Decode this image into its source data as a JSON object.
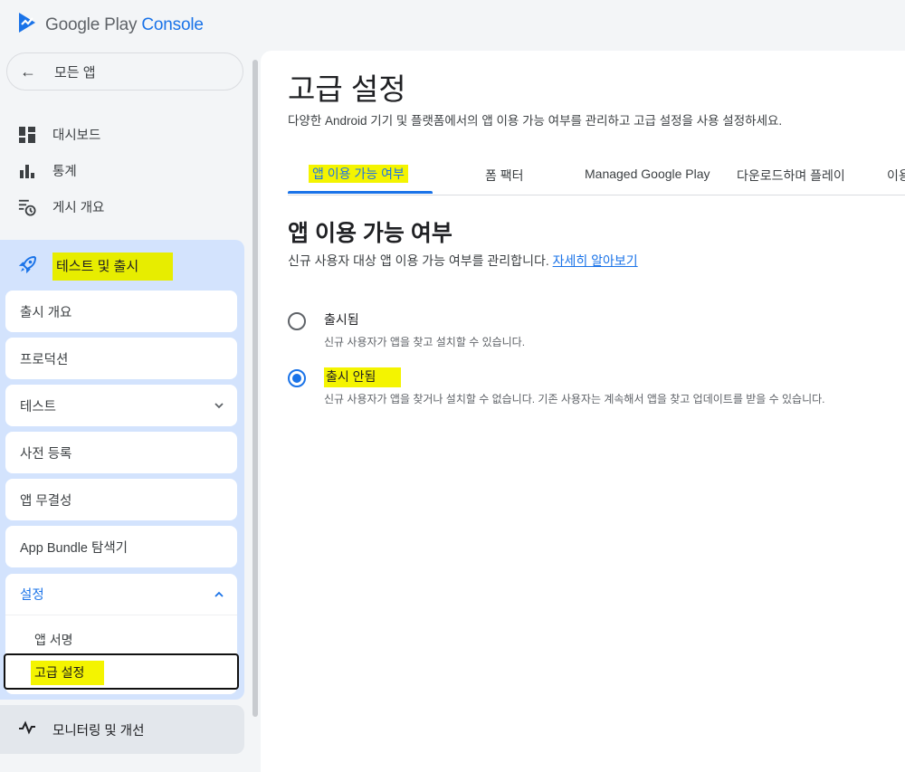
{
  "app": {
    "logo_text_main": "Google Play ",
    "logo_text_accent": "Console",
    "accent_color": "#1a73e8",
    "highlight_color": "#f4f400"
  },
  "sidebar": {
    "back_label": "모든 앱",
    "items": [
      {
        "label": "대시보드",
        "icon": "dashboard-icon"
      },
      {
        "label": "통계",
        "icon": "bar-chart-icon"
      },
      {
        "label": "게시 개요",
        "icon": "publishing-overview-icon"
      }
    ],
    "test_release": {
      "label": "테스트 및 출시",
      "icon": "rocket-icon",
      "sub_items": [
        {
          "label": "출시 개요"
        },
        {
          "label": "프로덕션"
        },
        {
          "label": "테스트",
          "icon": "chevron-down-icon"
        },
        {
          "label": "사전 등록"
        },
        {
          "label": "앱 무결성"
        },
        {
          "label": "App Bundle 탐색기"
        }
      ],
      "settings": {
        "label": "설정",
        "icon": "chevron-up-icon",
        "children": [
          "앱 서명",
          "고급 설정"
        ],
        "selected": "고급 설정"
      }
    },
    "monitor_label": "모니터링 및 개선"
  },
  "main": {
    "title": "고급 설정",
    "description": "다양한 Android 기기 및 플랫폼에서의 앱 이용 가능 여부를 관리하고 고급 설정을 사용 설정하세요.",
    "tabs": [
      "앱 이용 가능 여부",
      "폼 팩터",
      "Managed Google Play",
      "다운로드하며 플레이",
      "이용"
    ],
    "active_tab": "앱 이용 가능 여부",
    "section_title": "앱 이용 가능 여부",
    "section_desc": "신규 사용자 대상 앱 이용 가능 여부를 관리합니다. ",
    "section_link": "자세히 알아보기",
    "options": [
      {
        "label": "출시됨",
        "help": "신규 사용자가 앱을 찾고 설치할 수 있습니다.",
        "checked": false
      },
      {
        "label": "출시 안됨",
        "help": "신규 사용자가 앱을 찾거나 설치할 수 없습니다. 기존 사용자는 계속해서 앱을 찾고 업데이트를 받을 수 있습니다.",
        "checked": true
      }
    ]
  }
}
